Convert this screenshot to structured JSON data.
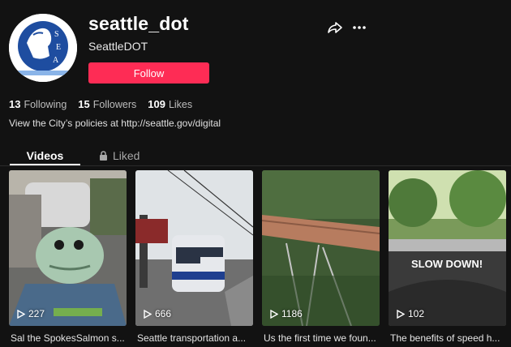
{
  "profile": {
    "username": "seattle_dot",
    "display_name": "SeattleDOT",
    "follow_label": "Follow",
    "bio": "View the City’s policies at http://seattle.gov/digital",
    "avatar_icon": "seattle-seal-icon"
  },
  "stats": {
    "following_count": "13",
    "following_label": "Following",
    "followers_count": "15",
    "followers_label": "Followers",
    "likes_count": "109",
    "likes_label": "Likes"
  },
  "tabs": {
    "videos": "Videos",
    "liked": "Liked"
  },
  "colors": {
    "background": "#121212",
    "accent": "#fe2c55"
  },
  "videos": [
    {
      "views": "227",
      "caption": "Sal the SpokesSalmon s...",
      "thumb_text": ""
    },
    {
      "views": "666",
      "caption": "Seattle transportation a...",
      "thumb_text": ""
    },
    {
      "views": "1186",
      "caption": "Us the first time we foun...",
      "thumb_text": ""
    },
    {
      "views": "102",
      "caption": "The benefits of speed h...",
      "thumb_text": "SLOW DOWN!"
    }
  ]
}
